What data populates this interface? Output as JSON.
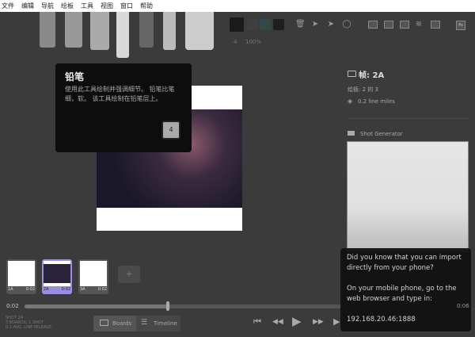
{
  "menu": [
    "文件",
    "编辑",
    "导航",
    "绘板",
    "工具",
    "视图",
    "窗口",
    "帮助"
  ],
  "toolbar": {
    "brush_size": "4",
    "opacity": "100%",
    "swatches": [
      "#1a1a1a",
      "#3a3a3a",
      "#2e4a4a",
      "#1e1e1e"
    ]
  },
  "tooltip": {
    "title": "铅笔",
    "body": "使用此工具绘制并强调细节。 铅笔比笔细，软。 该工具绘制在铅笔层上。",
    "shortcut": "4"
  },
  "info": {
    "frame": "帧: 2A",
    "board": "绘板: 2 的 3",
    "lines": "0.2 line miles",
    "shot_generator": "Shot Generator"
  },
  "thumbnails": [
    {
      "label": "1A",
      "time": "0:02",
      "selected": false
    },
    {
      "label": "2A",
      "time": "0:02",
      "selected": true
    },
    {
      "label": "3A",
      "time": "0:02",
      "selected": false
    }
  ],
  "add_label": "+",
  "timeline": {
    "current": "0:02",
    "end": "0:06",
    "progress": 0.5
  },
  "shot_summary": [
    "SHOT 2A",
    "3 BOARDS, 1 SHOT",
    "0.1 AVG. LINE MILEAGE"
  ],
  "view": {
    "boards": "Boards",
    "timeline": "Timeline"
  },
  "phone_tip": {
    "line1": "Did you know that you can import directly from your phone?",
    "line2": "On your mobile phone, go to the web browser and type in:",
    "address": "192.168.20.46:1888"
  },
  "accent": "#9a8ee0"
}
